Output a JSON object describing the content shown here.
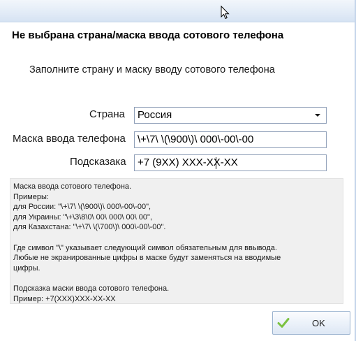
{
  "dialog": {
    "title": "Не выбрана страна/маска ввода сотового телефона",
    "subtitle": "Заполните страну и маску вводу сотового телефона"
  },
  "form": {
    "country_label": "Страна",
    "country_value": "Россия",
    "mask_label": "Маска ввода телефона",
    "mask_value": "\\+\\7\\ \\(\\900\\)\\ 000\\-00\\-00",
    "hint_label": "Подсказака",
    "hint_value": "+7 (9XX) XXX-XX-XX"
  },
  "help": {
    "lines": [
      "Маска ввода сотового телефона.",
      "Примеры:",
      "для России: \"\\+\\7\\ \\(\\900\\)\\ 000\\-00\\-00\",",
      "для Украины: \"\\+\\3\\8\\0\\ 00\\ 000\\ 00\\ 00\",",
      "для Казахстана: \"\\+\\7\\ \\(\\700\\)\\ 000\\-00\\-00\".",
      "",
      "Где символ \"\\\" указывает следующий символ обязательным для ввывода.",
      "Любые не экранированные цифры в маске будут заменяться на вводимые",
      "цифры.",
      "",
      "Подсказка маски ввода сотового телефона.",
      "Пример: +7(XXX)XXX-XX-XX"
    ]
  },
  "footer": {
    "ok_label": "OK"
  },
  "colors": {
    "accent_check": "#7cc242",
    "button_border": "#9bb3cf",
    "help_background": "#f0f0f0"
  },
  "icons": {
    "ok_button_icon": "check-icon",
    "select_arrow": "chevron-down-icon",
    "cursor": "mouse-pointer-icon"
  }
}
